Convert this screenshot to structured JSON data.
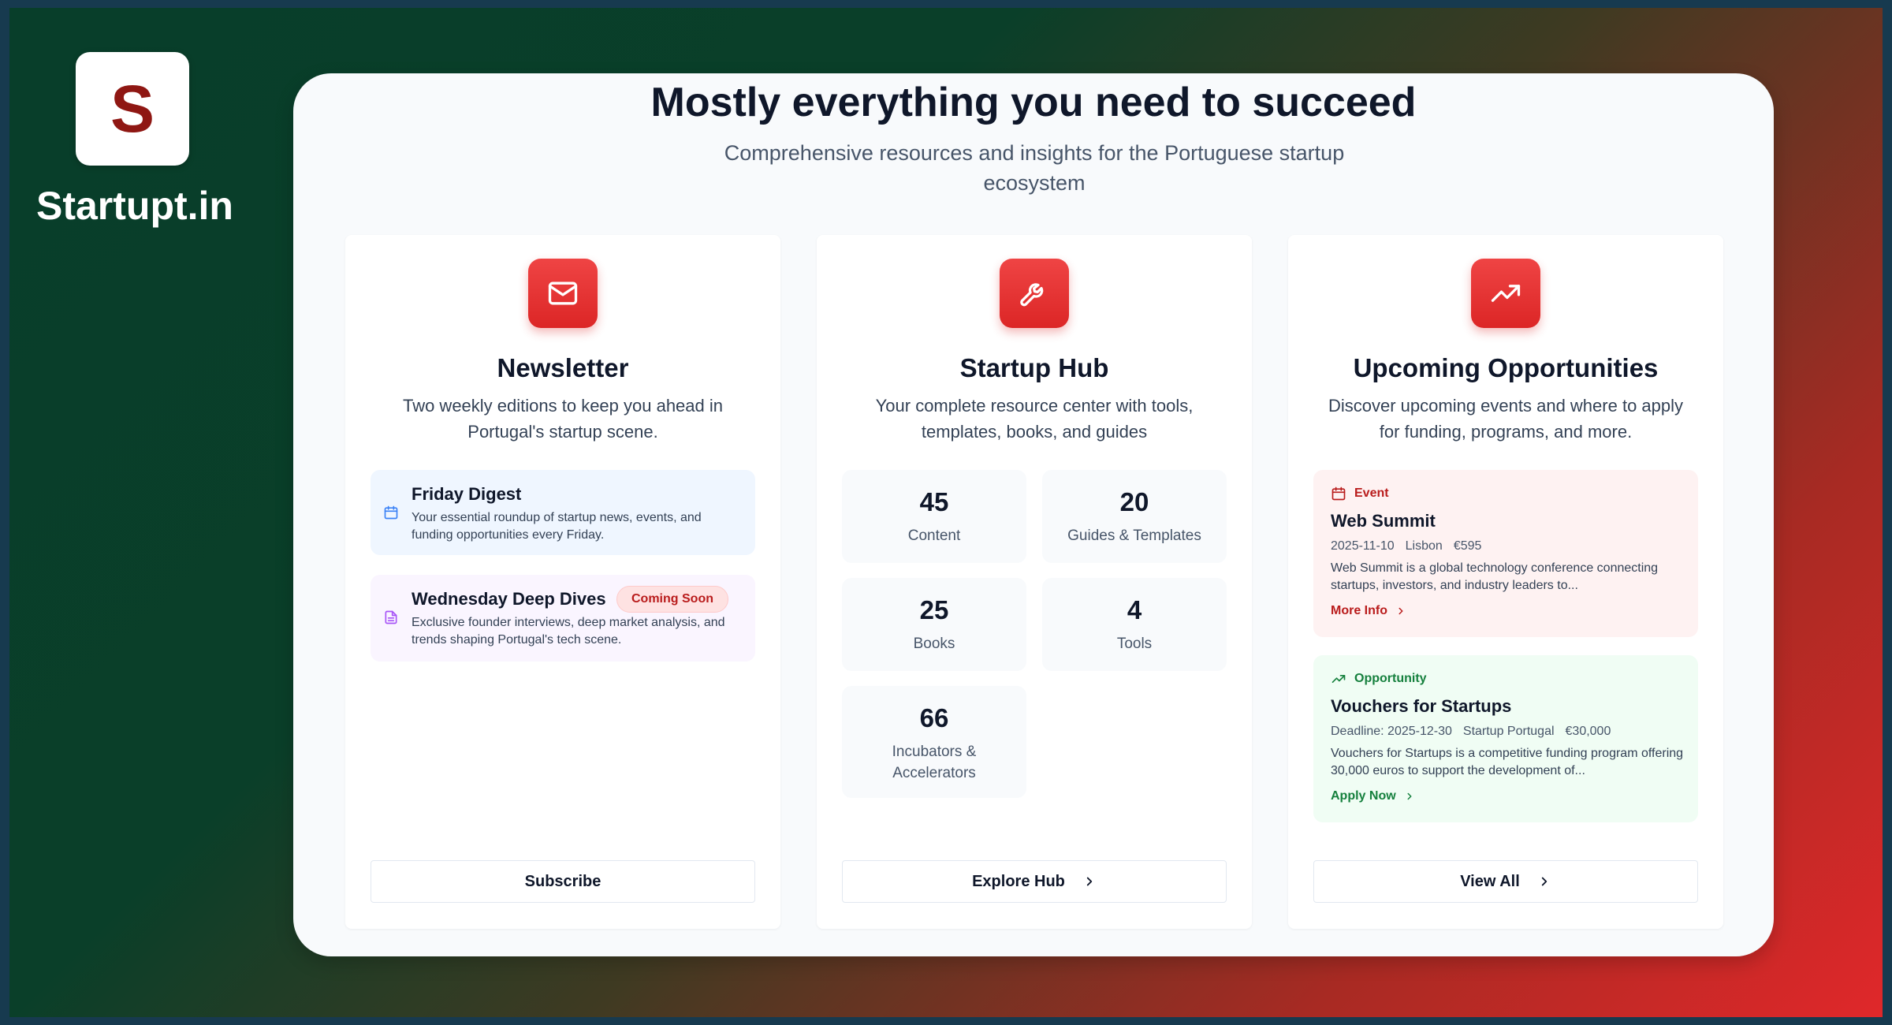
{
  "brand": {
    "letter": "S",
    "name": "Startupt.in"
  },
  "hero": {
    "title": "Mostly everything you need to succeed",
    "subtitle": "Comprehensive resources and insights for the Portuguese startup ecosystem"
  },
  "newsletter": {
    "icon": "mail-icon",
    "title": "Newsletter",
    "description": "Two weekly editions to keep you ahead in Portugal's startup scene.",
    "items": [
      {
        "icon": "calendar-icon",
        "title": "Friday Digest",
        "text": "Your essential roundup of startup news, events, and funding opportunities every Friday."
      },
      {
        "icon": "document-icon",
        "title": "Wednesday Deep Dives",
        "badge": "Coming Soon",
        "text": "Exclusive founder interviews, deep market analysis, and trends shaping Portugal's tech scene."
      }
    ],
    "button": "Subscribe"
  },
  "hub": {
    "icon": "wrench-icon",
    "title": "Startup Hub",
    "description": "Your complete resource center with tools, templates, books, and guides",
    "stats": [
      {
        "value": "45",
        "label": "Content"
      },
      {
        "value": "20",
        "label": "Guides & Templates"
      },
      {
        "value": "25",
        "label": "Books"
      },
      {
        "value": "4",
        "label": "Tools"
      },
      {
        "value": "66",
        "label": "Incubators & Accelerators"
      }
    ],
    "button": "Explore Hub"
  },
  "opportunities": {
    "icon": "trending-up-icon",
    "title": "Upcoming Opportunities",
    "description": "Discover upcoming events and where to apply for funding, programs, and more.",
    "items": [
      {
        "tag": "Event",
        "icon": "calendar-icon",
        "title": "Web Summit",
        "meta": [
          "2025-11-10",
          "Lisbon",
          "€595"
        ],
        "text": "Web Summit is a global technology conference connecting startups, investors, and industry leaders to...",
        "link": "More Info"
      },
      {
        "tag": "Opportunity",
        "icon": "trending-up-icon",
        "title": "Vouchers for Startups",
        "meta": [
          "Deadline: 2025-12-30",
          "Startup Portugal",
          "€30,000"
        ],
        "text": "Vouchers for Startups is a competitive funding program offering 30,000 euros to support the development of...",
        "link": "Apply Now"
      }
    ],
    "button": "View All"
  },
  "colors": {
    "accent": "#dc2626",
    "event": "#b91c1c",
    "opportunity": "#15803d"
  }
}
